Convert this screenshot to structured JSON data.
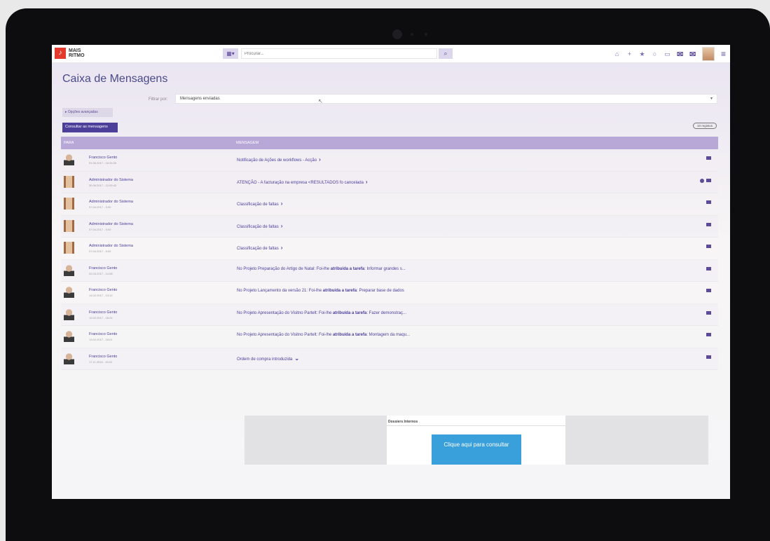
{
  "app": {
    "logo_line1": "MAIS",
    "logo_line2": "RITMO"
  },
  "search": {
    "placeholder": "Procurar..."
  },
  "page": {
    "title": "Caixa de Mensagens",
    "filter_label": "Filtrar por:",
    "filter_value": "Mensagens enviadas",
    "advanced_options": "▸ Opções avançadas",
    "consult_button": "Consultar as mensagens",
    "page_badge": "10 registos"
  },
  "table": {
    "col_to": "PARA",
    "col_message": "MENSAGEM",
    "rows": [
      {
        "name": "Francisco Gento",
        "date": "01.06.2017 - 16:26:26",
        "message": "Notificação de Ações de workflows - Acção",
        "avatar": "man",
        "chevron": "›",
        "icons": 1
      },
      {
        "name": "Administrador do Sistema",
        "date": "30.06.2017 - 12:05:42",
        "message": "ATENÇÃO - A facturação na empresa <RESULTADOS fo cancelada",
        "avatar": "woman",
        "chevron": "›",
        "icons": 2
      },
      {
        "name": "Administrador do Sistema",
        "date": "07.04.2017 - 9:00",
        "message": "Classificação de faltas",
        "avatar": "woman",
        "chevron": "›",
        "icons": 1
      },
      {
        "name": "Administrador do Sistema",
        "date": "07.04.2017 - 9:00",
        "message": "Classificação de faltas",
        "avatar": "woman",
        "chevron": "›",
        "icons": 1
      },
      {
        "name": "Administrador do Sistema",
        "date": "07.04.2017 - 9:00",
        "message": "Classificação de faltas",
        "avatar": "woman",
        "chevron": "›",
        "icons": 1
      },
      {
        "name": "Francisco Gento",
        "date": "02.03.2017 - 14:08",
        "message_pre": "No Projeto Preparação do Artigo de Natal: Foi-lhe ",
        "message_bold": "atribuída a tarefa",
        "message_post": ": Informar grandes s...",
        "avatar": "man",
        "icons": 1
      },
      {
        "name": "Francisco Gento",
        "date": "14.02.2017 - 13:12",
        "message_pre": "No Projeto Lançamento da versão 21: Foi-lhe ",
        "message_bold": "atribuída a tarefa",
        "message_post": ": Preparar base de dados",
        "avatar": "man",
        "icons": 1
      },
      {
        "name": "Francisco Gento",
        "date": "13.02.2017 - 18:24",
        "message_pre": "No Projeto Apresentação do Visitno Partelt: Foi-lhe ",
        "message_bold": "atribuída a tarefa",
        "message_post": ": Fazer demonstraç...",
        "avatar": "man",
        "icons": 1
      },
      {
        "name": "Francisco Gento",
        "date": "13.02.2017 - 18:01",
        "message_pre": "No Projeto Apresentação do Visitno Partelt: Foi-lhe ",
        "message_bold": "atribuída a tarefa",
        "message_post": ": Montagem da maqu...",
        "avatar": "man",
        "icons": 1
      },
      {
        "name": "Francisco Gento",
        "date": "17.11.2016 - 16:02",
        "message": "Ordem de compra introduzida",
        "avatar": "man",
        "chevron": "⌄",
        "icons": 1
      }
    ]
  },
  "preview": {
    "title": "Dossiers Internos",
    "cta": "Clique aqui para consultar"
  },
  "colors": {
    "accent": "#4b3f9a",
    "header": "#b8a8d8",
    "cta": "#3aa0db"
  }
}
